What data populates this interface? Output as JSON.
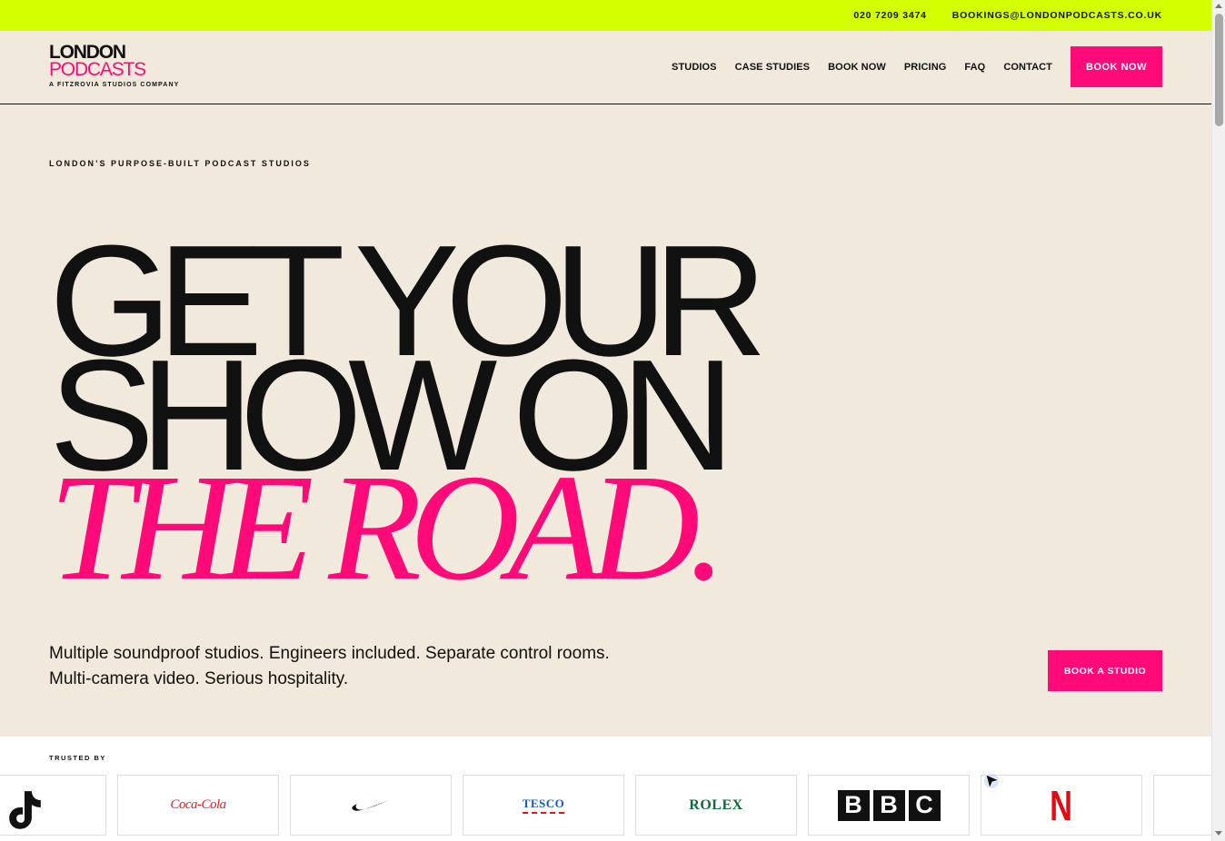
{
  "topbar": {
    "phone": "020 7209 3474",
    "email": "BOOKINGS@LONDONPODCASTS.CO.UK",
    "bg_color": "#d4ff00"
  },
  "logo": {
    "line1": "LONDON",
    "line2": "PODCASTS",
    "tagline": "A FITZROVIA STUDIOS COMPANY"
  },
  "nav": {
    "items": [
      "STUDIOS",
      "CASE STUDIES",
      "BOOK NOW",
      "PRICING",
      "FAQ",
      "CONTACT"
    ],
    "cta": "BOOK NOW"
  },
  "hero": {
    "eyebrow": "LONDON’S PURPOSE-BUILT PODCAST STUDIOS",
    "line1": "GET YOUR",
    "line2": "SHOW ON",
    "line3": "THE ROAD.",
    "sub_line1": "Multiple soundproof studios. Engineers included. Separate control rooms.",
    "sub_line2": "Multi-camera video. Serious hospitality.",
    "cta": "BOOK A STUDIO"
  },
  "trusted": {
    "label": "TRUSTED BY",
    "logos": [
      {
        "name": "tiktok-logo",
        "text": ""
      },
      {
        "name": "coca-cola-logo",
        "text": "Coca-Cola"
      },
      {
        "name": "nike-logo",
        "text": ""
      },
      {
        "name": "tesco-logo",
        "text": "TESCO"
      },
      {
        "name": "rolex-logo",
        "text": "ROLEX"
      },
      {
        "name": "bbc-logo",
        "text": "BBC"
      },
      {
        "name": "netflix-logo",
        "text": "N"
      }
    ]
  },
  "colors": {
    "accent": "#ff0a78",
    "background": "#f0e9dc",
    "text": "#111111"
  }
}
